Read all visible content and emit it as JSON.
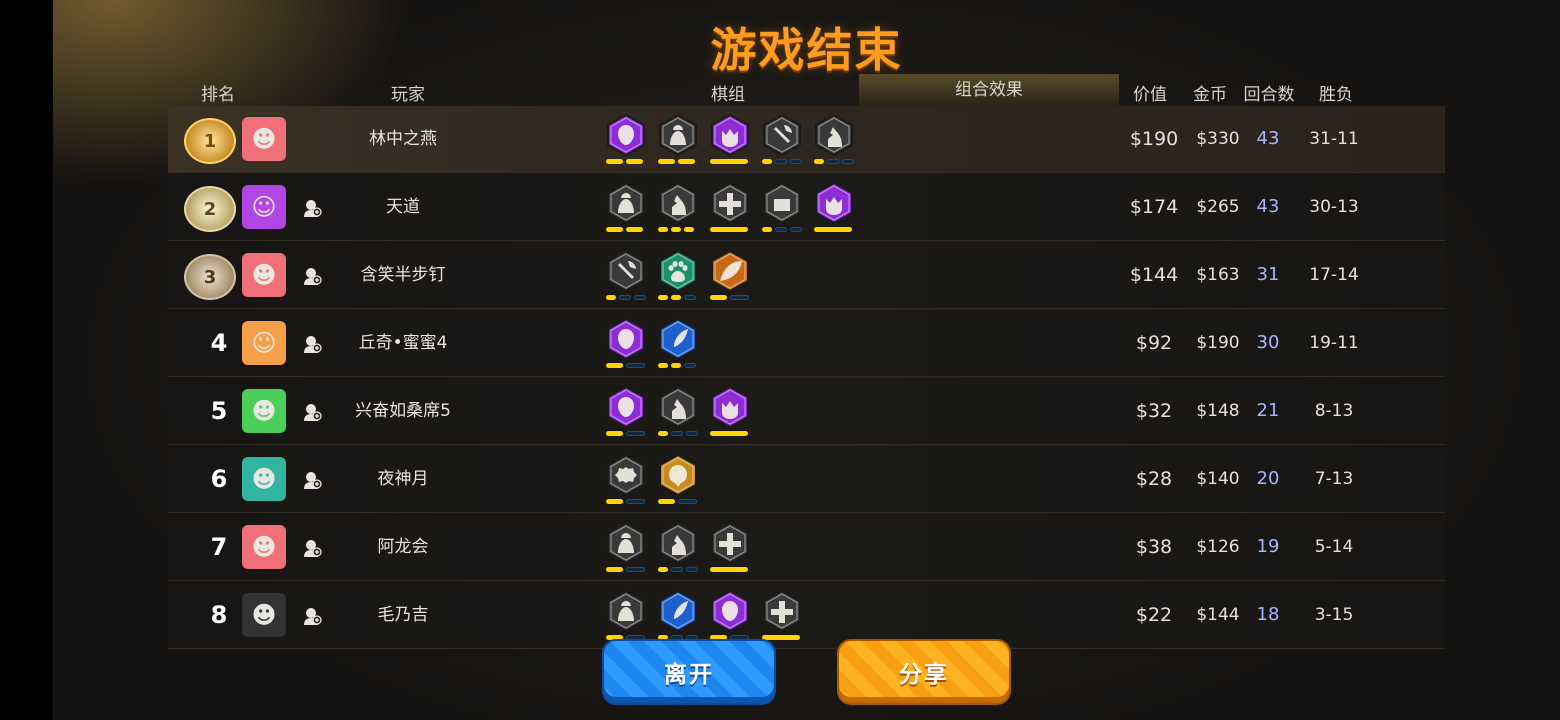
{
  "title": "游戏结束",
  "headers": {
    "rank": "排名",
    "player": "玩家",
    "pieces": "棋组",
    "effects": "组合效果",
    "value": "价值",
    "gold": "金币",
    "rounds": "回合数",
    "winloss": "胜负"
  },
  "colors": {
    "title": "#ff9b1e",
    "pip_on": "#ffd400",
    "pip_off": "#0f2a44",
    "purple": "#8e2cd6",
    "gray": "#3a3a3a",
    "pink": "#c0608e",
    "blue": "#1d5fcf",
    "green": "#1a8f6a",
    "orange": "#c86a14",
    "gold": "#c88a1a"
  },
  "players": [
    {
      "rank": "1",
      "medal": "gold",
      "avatar": "pink-monster",
      "name": "林中之燕",
      "value": "$190",
      "gold": "$330",
      "rounds": "43",
      "winloss": "31-11",
      "synergies": [
        {
          "icon": "mage-icon",
          "bg": "purple",
          "pips": [
            1,
            1
          ]
        },
        {
          "icon": "knight-icon",
          "bg": "gray",
          "pips": [
            1,
            1
          ]
        },
        {
          "icon": "demon-icon",
          "bg": "purple",
          "pips": [
            1
          ]
        },
        {
          "icon": "axe-icon",
          "bg": "gray",
          "pips": [
            1,
            0,
            0
          ]
        },
        {
          "icon": "horse-icon",
          "bg": "gray",
          "pips": [
            1,
            0,
            0
          ]
        }
      ]
    },
    {
      "rank": "2",
      "medal": "silver",
      "avatar": "boy-avatar",
      "name": "天道",
      "value": "$174",
      "gold": "$265",
      "rounds": "43",
      "winloss": "30-13",
      "synergies": [
        {
          "icon": "knight-icon",
          "bg": "gray",
          "pips": [
            1,
            1
          ]
        },
        {
          "icon": "horse-icon",
          "bg": "gray",
          "pips": [
            1,
            1,
            1
          ]
        },
        {
          "icon": "cross-icon",
          "bg": "gray",
          "pips": [
            1
          ]
        },
        {
          "icon": "robot-icon",
          "bg": "gray",
          "pips": [
            1,
            0,
            0
          ]
        },
        {
          "icon": "demon-icon",
          "bg": "purple",
          "pips": [
            1
          ]
        }
      ]
    },
    {
      "rank": "3",
      "medal": "bronze",
      "avatar": "pink-monster",
      "name": "含笑半步钉",
      "value": "$144",
      "gold": "$163",
      "rounds": "31",
      "winloss": "17-14",
      "synergies": [
        {
          "icon": "axe-icon",
          "bg": "gray",
          "pips": [
            1,
            0,
            0
          ]
        },
        {
          "icon": "paw-icon",
          "bg": "green",
          "pips": [
            1,
            1,
            0
          ]
        },
        {
          "icon": "leaf-icon",
          "bg": "orange",
          "pips": [
            1,
            0
          ]
        }
      ]
    },
    {
      "rank": "4",
      "medal": "",
      "avatar": "girl-avatar",
      "name": "丘奇•蜜蜜4",
      "value": "$92",
      "gold": "$190",
      "rounds": "30",
      "winloss": "19-11",
      "synergies": [
        {
          "icon": "mage-icon",
          "bg": "purple",
          "pips": [
            1,
            0
          ]
        },
        {
          "icon": "feather-icon",
          "bg": "blue",
          "pips": [
            1,
            1,
            0
          ]
        }
      ]
    },
    {
      "rank": "5",
      "medal": "",
      "avatar": "green-monster",
      "name": "兴奋如桑席5",
      "value": "$32",
      "gold": "$148",
      "rounds": "21",
      "winloss": "8-13",
      "synergies": [
        {
          "icon": "mage-icon",
          "bg": "purple",
          "pips": [
            1,
            0
          ]
        },
        {
          "icon": "horse-icon",
          "bg": "gray",
          "pips": [
            1,
            0,
            0
          ]
        },
        {
          "icon": "demon-icon",
          "bg": "purple",
          "pips": [
            1
          ]
        }
      ]
    },
    {
      "rank": "6",
      "medal": "",
      "avatar": "dragon-avatar",
      "name": "夜神月",
      "value": "$28",
      "gold": "$140",
      "rounds": "20",
      "winloss": "7-13",
      "synergies": [
        {
          "icon": "gear-icon",
          "bg": "gray",
          "pips": [
            1,
            0
          ]
        },
        {
          "icon": "spirit-icon",
          "bg": "gold",
          "pips": [
            1,
            0
          ]
        }
      ]
    },
    {
      "rank": "7",
      "medal": "",
      "avatar": "pink-monster",
      "name": "阿龙会",
      "value": "$38",
      "gold": "$126",
      "rounds": "19",
      "winloss": "5-14",
      "synergies": [
        {
          "icon": "knight-icon",
          "bg": "gray",
          "pips": [
            1,
            0
          ]
        },
        {
          "icon": "horse-icon",
          "bg": "gray",
          "pips": [
            1,
            0,
            0
          ]
        },
        {
          "icon": "cross-icon",
          "bg": "gray",
          "pips": [
            1
          ]
        }
      ]
    },
    {
      "rank": "8",
      "medal": "",
      "avatar": "ninja-avatar",
      "name": "毛乃吉",
      "value": "$22",
      "gold": "$144",
      "rounds": "18",
      "winloss": "3-15",
      "synergies": [
        {
          "icon": "knight-icon",
          "bg": "gray",
          "pips": [
            1,
            0
          ]
        },
        {
          "icon": "feather-icon",
          "bg": "blue",
          "pips": [
            1,
            0,
            0
          ]
        },
        {
          "icon": "mage-icon",
          "bg": "purple",
          "pips": [
            1,
            0
          ]
        },
        {
          "icon": "cross-icon",
          "bg": "gray",
          "pips": [
            1
          ]
        }
      ]
    }
  ],
  "buttons": {
    "leave": "离开",
    "share": "分享"
  }
}
